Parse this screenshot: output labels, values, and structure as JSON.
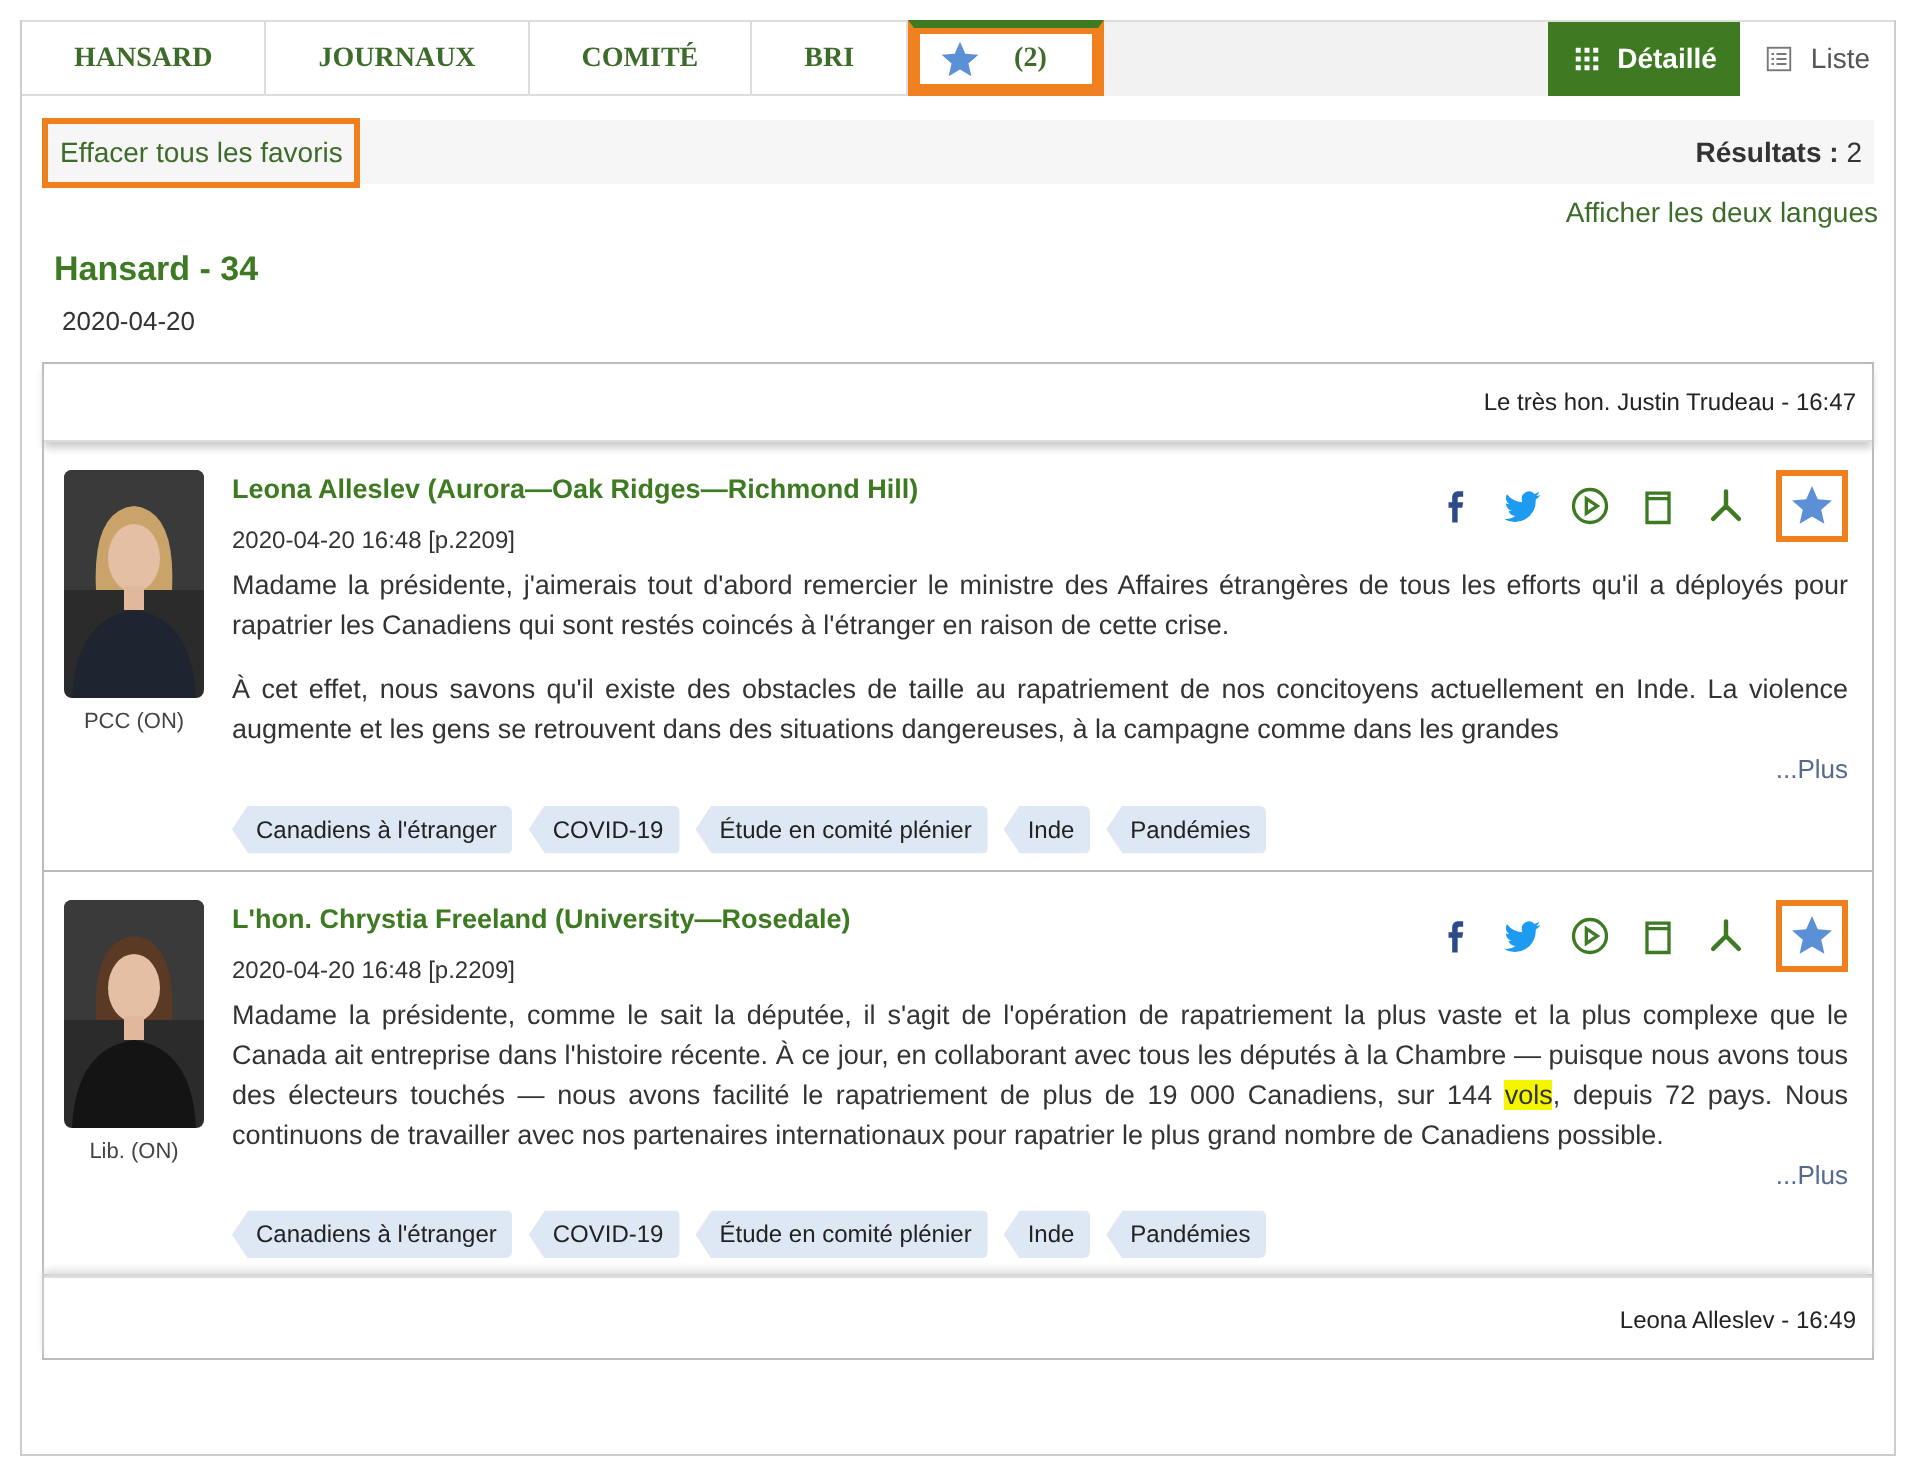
{
  "tabs": [
    {
      "label": "HANSARD",
      "kind": "text",
      "selected": false,
      "highlighted": false
    },
    {
      "label": "JOURNAUX",
      "kind": "text",
      "selected": false,
      "highlighted": false
    },
    {
      "label": "COMITÉ",
      "kind": "text",
      "selected": false,
      "highlighted": false
    },
    {
      "label": "BRI",
      "kind": "text",
      "selected": false,
      "highlighted": false
    },
    {
      "label": "(2)",
      "kind": "favorites",
      "selected": true,
      "highlighted": true
    }
  ],
  "view_toggle": [
    {
      "label": "Détaillé",
      "kind": "grid",
      "selected": true
    },
    {
      "label": "Liste",
      "kind": "list",
      "selected": false
    }
  ],
  "toolbar": {
    "clear_link": {
      "label": "Effacer tous les favoris",
      "highlighted": true
    },
    "results_label": "Résultats :",
    "results_count": "2"
  },
  "language_link": "Afficher les deux langues",
  "sitting": {
    "title": "Hansard - 34",
    "date": "2020-04-20"
  },
  "results": {
    "header": "Le très hon. Justin Trudeau - 16:47",
    "footer": "Leona Alleslev - 16:49",
    "speeches": [
      {
        "speaker": "Leona Alleslev (Aurora—Oak Ridges—Richmond Hill)",
        "affiliation": "PCC (ON)",
        "timestamp": "2020-04-20 16:48 [p.2209]",
        "favorite": true,
        "highlighted": true,
        "paragraphs": [
          [
            {
              "text": "Madame la présidente, j'aimerais tout d'abord remercier le ministre des Affaires étrangères de tous les efforts qu'il a déployés pour rapatrier les Canadiens qui sont restés coincés à l'étranger en raison de cette crise.",
              "highlighted": false
            }
          ],
          [
            {
              "text": "À cet effet, nous savons qu'il existe des obstacles de taille au rapatriement de nos concitoyens actuellement en Inde. La violence augmente et les gens se retrouvent dans des situations dangereuses, à la campagne comme dans les grandes",
              "highlighted": false
            }
          ]
        ],
        "more": "...Plus",
        "tags": [
          "Canadiens à l'étranger",
          "COVID-19",
          "Étude en comité plénier",
          "Inde",
          "Pandémies"
        ]
      },
      {
        "speaker": "L'hon. Chrystia Freeland (University—Rosedale)",
        "affiliation": "Lib. (ON)",
        "timestamp": "2020-04-20 16:48 [p.2209]",
        "favorite": true,
        "highlighted": true,
        "paragraphs": [
          [
            {
              "text": "Madame la présidente, comme le sait la députée, il s'agit de l'opération de rapatriement la plus vaste et la plus complexe que le Canada ait entreprise dans l'histoire récente. À ce jour, en collaborant avec tous les députés à la Chambre — puisque nous avons tous des électeurs touchés — nous avons facilité le rapatriement de plus de 19 000 Canadiens, sur 144 ",
              "highlighted": false
            },
            {
              "text": "vols",
              "highlighted": true
            },
            {
              "text": ", depuis 72 pays. Nous continuons de travailler avec nos partenaires internationaux pour rapatrier le plus grand nombre de Canadiens possible.",
              "highlighted": false
            }
          ]
        ],
        "more": "...Plus",
        "tags": [
          "Canadiens à l'étranger",
          "COVID-19",
          "Étude en comité plénier",
          "Inde",
          "Pandémies"
        ]
      }
    ]
  }
}
